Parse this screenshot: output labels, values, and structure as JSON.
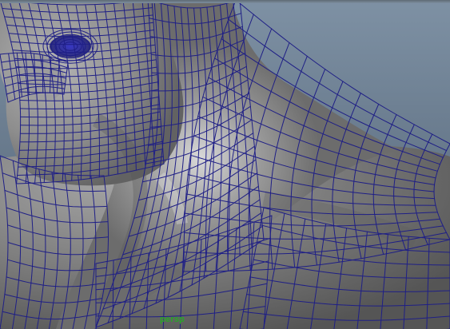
{
  "viewport": {
    "camera_label": "persp",
    "background_top_color": "#7e91a4",
    "background_bottom_color": "#526274",
    "mesh_wire_color": "#1f1f86",
    "camera_label_color": "#27a627"
  }
}
